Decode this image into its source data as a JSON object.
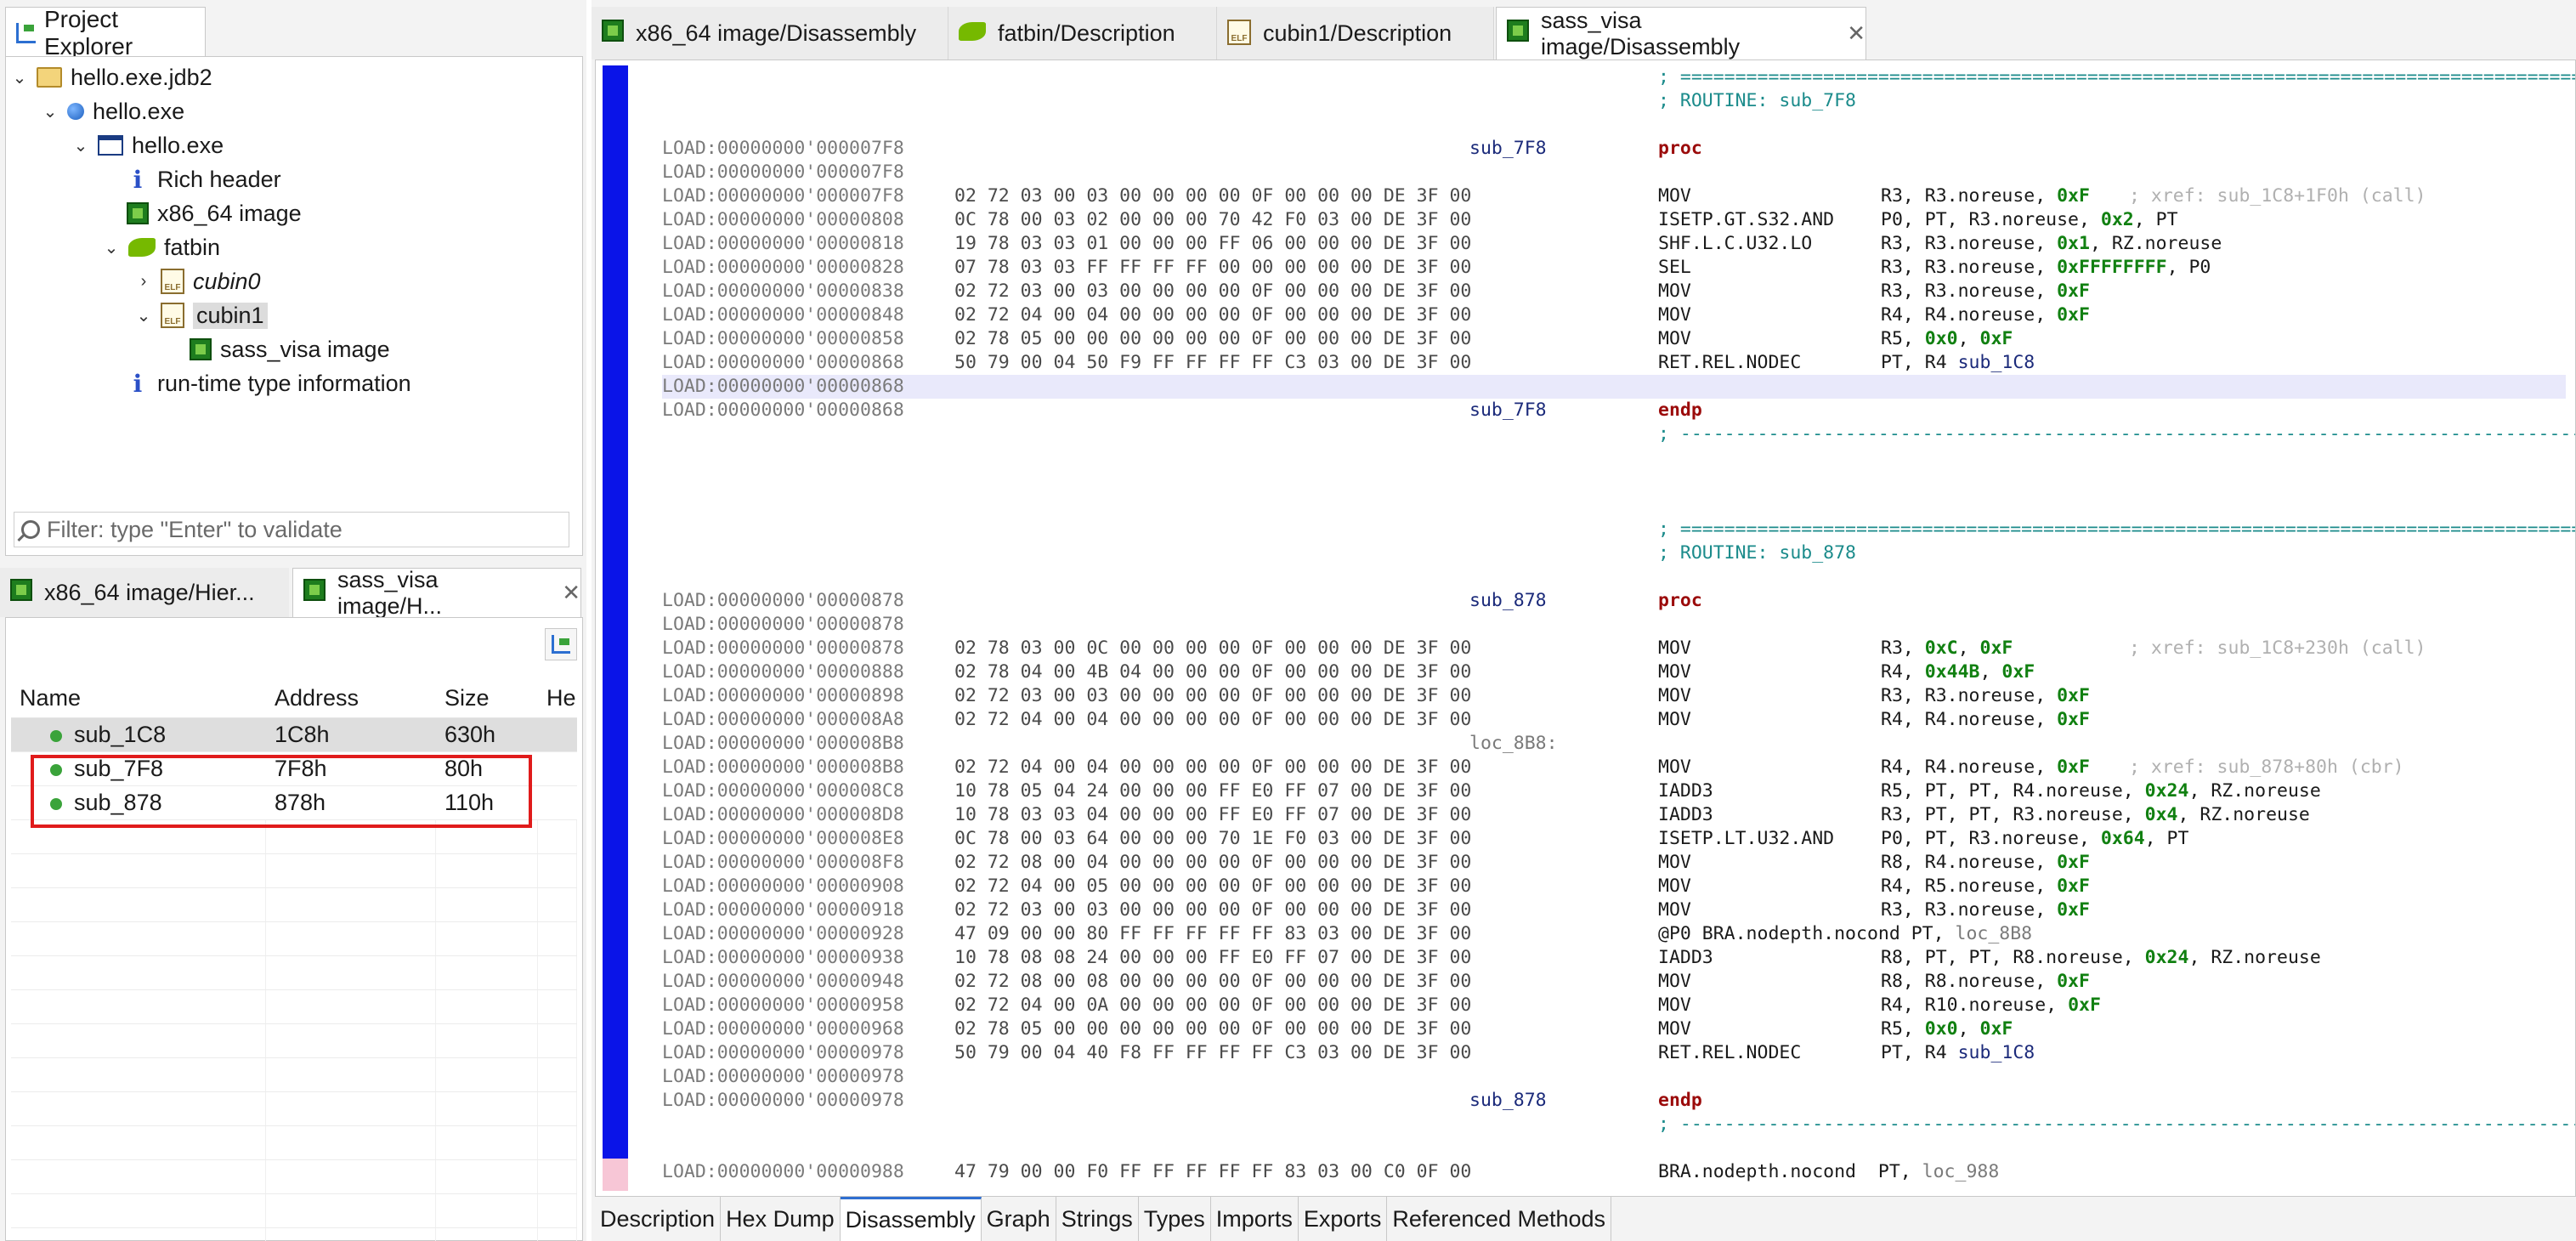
{
  "project_explorer": {
    "tab_label": "Project Explorer",
    "tree": [
      {
        "label": "hello.exe.jdb2",
        "icon": "folder-icon",
        "expanded": true
      },
      {
        "label": "hello.exe",
        "icon": "artifact-icon",
        "expanded": true
      },
      {
        "label": "hello.exe",
        "icon": "window-icon",
        "expanded": true
      },
      {
        "label": "Rich header",
        "icon": "info-icon"
      },
      {
        "label": "x86_64 image",
        "icon": "chip-icon"
      },
      {
        "label": "fatbin",
        "icon": "nvidia-icon",
        "expanded": true
      },
      {
        "label": "cubin0",
        "icon": "elf-icon",
        "expanded": false
      },
      {
        "label": "cubin1",
        "icon": "elf-icon",
        "expanded": true
      },
      {
        "label": "sass_visa image",
        "icon": "chip-icon"
      },
      {
        "label": "run-time type information",
        "icon": "info-icon"
      }
    ],
    "filter_placeholder": "Filter: type \"Enter\" to validate"
  },
  "hierarchy": {
    "tabs": [
      {
        "label": "x86_64 image/Hier..."
      },
      {
        "label": "sass_visa image/H..."
      }
    ],
    "columns": [
      "Name",
      "Address",
      "Size",
      "Hei"
    ],
    "rows": [
      {
        "name": "sub_1C8",
        "address": "1C8h",
        "size": "630h"
      },
      {
        "name": "sub_7F8",
        "address": "7F8h",
        "size": "80h"
      },
      {
        "name": "sub_878",
        "address": "878h",
        "size": "110h"
      }
    ]
  },
  "editor_tabs": [
    {
      "label": "x86_64 image/Disassembly"
    },
    {
      "label": "fatbin/Description"
    },
    {
      "label": "cubin1/Description"
    },
    {
      "label": "sass_visa image/Disassembly"
    }
  ],
  "disassembly": {
    "lines": [
      {
        "sep": "; ==================================================================================================="
      },
      {
        "sep": "; ROUTINE: sub_7F8"
      },
      {},
      {
        "addr": "LOAD:00000000'000007F8",
        "label": "sub_7F8",
        "mn": "proc",
        "kw": true
      },
      {
        "addr": "LOAD:00000000'000007F8"
      },
      {
        "addr": "LOAD:00000000'000007F8",
        "bytes": "02 72 03 00 03 00 00 00 00 0F 00 00 00 DE 3F 00",
        "mn": "MOV",
        "ops": [
          [
            "R3, R3.noreuse, ",
            ""
          ],
          [
            "0xF",
            "hex"
          ]
        ],
        "cm": "; xref: sub_1C8+1F0h (call)"
      },
      {
        "addr": "LOAD:00000000'00000808",
        "bytes": "0C 78 00 03 02 00 00 00 70 42 F0 03 00 DE 3F 00",
        "mn": "ISETP.GT.S32.AND",
        "ops": [
          [
            "P0, PT, R3.noreuse, ",
            ""
          ],
          [
            "0x2",
            "hex"
          ],
          [
            ", PT",
            ""
          ]
        ]
      },
      {
        "addr": "LOAD:00000000'00000818",
        "bytes": "19 78 03 03 01 00 00 00 FF 06 00 00 00 DE 3F 00",
        "mn": "SHF.L.C.U32.LO",
        "ops": [
          [
            "R3, R3.noreuse, ",
            ""
          ],
          [
            "0x1",
            "hex"
          ],
          [
            ", RZ.noreuse",
            ""
          ]
        ]
      },
      {
        "addr": "LOAD:00000000'00000828",
        "bytes": "07 78 03 03 FF FF FF FF 00 00 00 00 00 DE 3F 00",
        "mn": "SEL",
        "ops": [
          [
            "R3, R3.noreuse, ",
            ""
          ],
          [
            "0xFFFFFFFF",
            "hex"
          ],
          [
            ", P0",
            ""
          ]
        ]
      },
      {
        "addr": "LOAD:00000000'00000838",
        "bytes": "02 72 03 00 03 00 00 00 00 0F 00 00 00 DE 3F 00",
        "mn": "MOV",
        "ops": [
          [
            "R3, R3.noreuse, ",
            ""
          ],
          [
            "0xF",
            "hex"
          ]
        ]
      },
      {
        "addr": "LOAD:00000000'00000848",
        "bytes": "02 72 04 00 04 00 00 00 00 0F 00 00 00 DE 3F 00",
        "mn": "MOV",
        "ops": [
          [
            "R4, R4.noreuse, ",
            ""
          ],
          [
            "0xF",
            "hex"
          ]
        ]
      },
      {
        "addr": "LOAD:00000000'00000858",
        "bytes": "02 78 05 00 00 00 00 00 00 0F 00 00 00 DE 3F 00",
        "mn": "MOV",
        "ops": [
          [
            "R5, ",
            ""
          ],
          [
            "0x0",
            "hex"
          ],
          [
            ", ",
            ""
          ],
          [
            "0xF",
            "hex"
          ]
        ]
      },
      {
        "addr": "LOAD:00000000'00000868",
        "bytes": "50 79 00 04 50 F9 FF FF FF FF C3 03 00 DE 3F 00",
        "mn": "RET.REL.NODEC",
        "ops": [
          [
            "PT, R4 ",
            ""
          ],
          [
            "sub_1C8",
            "ref"
          ]
        ]
      },
      {
        "addr": "LOAD:00000000'00000868",
        "hl": true
      },
      {
        "addr": "LOAD:00000000'00000868",
        "label": "sub_7F8",
        "mn": "endp",
        "kw": true
      },
      {
        "sep": "; ---------------------------------------------------------------------------------------------------"
      },
      {},
      {},
      {},
      {
        "sep": "; ==================================================================================================="
      },
      {
        "sep": "; ROUTINE: sub_878"
      },
      {},
      {
        "addr": "LOAD:00000000'00000878",
        "label": "sub_878",
        "mn": "proc",
        "kw": true
      },
      {
        "addr": "LOAD:00000000'00000878"
      },
      {
        "addr": "LOAD:00000000'00000878",
        "bytes": "02 78 03 00 0C 00 00 00 00 0F 00 00 00 DE 3F 00",
        "mn": "MOV",
        "ops": [
          [
            "R3, ",
            ""
          ],
          [
            "0xC",
            "hex"
          ],
          [
            ", ",
            ""
          ],
          [
            "0xF",
            "hex"
          ]
        ],
        "cm": "; xref: sub_1C8+230h (call)"
      },
      {
        "addr": "LOAD:00000000'00000888",
        "bytes": "02 78 04 00 4B 04 00 00 00 0F 00 00 00 DE 3F 00",
        "mn": "MOV",
        "ops": [
          [
            "R4, ",
            ""
          ],
          [
            "0x44B",
            "hex"
          ],
          [
            ", ",
            ""
          ],
          [
            "0xF",
            "hex"
          ]
        ]
      },
      {
        "addr": "LOAD:00000000'00000898",
        "bytes": "02 72 03 00 03 00 00 00 00 0F 00 00 00 DE 3F 00",
        "mn": "MOV",
        "ops": [
          [
            "R3, R3.noreuse, ",
            ""
          ],
          [
            "0xF",
            "hex"
          ]
        ]
      },
      {
        "addr": "LOAD:00000000'000008A8",
        "bytes": "02 72 04 00 04 00 00 00 00 0F 00 00 00 DE 3F 00",
        "mn": "MOV",
        "ops": [
          [
            "R4, R4.noreuse, ",
            ""
          ],
          [
            "0xF",
            "hex"
          ]
        ]
      },
      {
        "addr": "LOAD:00000000'000008B8",
        "label": "loc_8B8:",
        "labelgray": true
      },
      {
        "addr": "LOAD:00000000'000008B8",
        "bytes": "02 72 04 00 04 00 00 00 00 0F 00 00 00 DE 3F 00",
        "mn": "MOV",
        "ops": [
          [
            "R4, R4.noreuse, ",
            ""
          ],
          [
            "0xF",
            "hex"
          ]
        ],
        "cm": "; xref: sub_878+80h (cbr)"
      },
      {
        "addr": "LOAD:00000000'000008C8",
        "bytes": "10 78 05 04 24 00 00 00 FF E0 FF 07 00 DE 3F 00",
        "mn": "IADD3",
        "ops": [
          [
            "R5, PT, PT, R4.noreuse, ",
            ""
          ],
          [
            "0x24",
            "hex"
          ],
          [
            ", RZ.noreuse",
            ""
          ]
        ]
      },
      {
        "addr": "LOAD:00000000'000008D8",
        "bytes": "10 78 03 03 04 00 00 00 FF E0 FF 07 00 DE 3F 00",
        "mn": "IADD3",
        "ops": [
          [
            "R3, PT, PT, R3.noreuse, ",
            ""
          ],
          [
            "0x4",
            "hex"
          ],
          [
            ", RZ.noreuse",
            ""
          ]
        ]
      },
      {
        "addr": "LOAD:00000000'000008E8",
        "bytes": "0C 78 00 03 64 00 00 00 70 1E F0 03 00 DE 3F 00",
        "mn": "ISETP.LT.U32.AND",
        "ops": [
          [
            "P0, PT, R3.noreuse, ",
            ""
          ],
          [
            "0x64",
            "hex"
          ],
          [
            ", PT",
            ""
          ]
        ]
      },
      {
        "addr": "LOAD:00000000'000008F8",
        "bytes": "02 72 08 00 04 00 00 00 00 0F 00 00 00 DE 3F 00",
        "mn": "MOV",
        "ops": [
          [
            "R8, R4.noreuse, ",
            ""
          ],
          [
            "0xF",
            "hex"
          ]
        ]
      },
      {
        "addr": "LOAD:00000000'00000908",
        "bytes": "02 72 04 00 05 00 00 00 00 0F 00 00 00 DE 3F 00",
        "mn": "MOV",
        "ops": [
          [
            "R4, R5.noreuse, ",
            ""
          ],
          [
            "0xF",
            "hex"
          ]
        ]
      },
      {
        "addr": "LOAD:00000000'00000918",
        "bytes": "02 72 03 00 03 00 00 00 00 0F 00 00 00 DE 3F 00",
        "mn": "MOV",
        "ops": [
          [
            "R3, R3.noreuse, ",
            ""
          ],
          [
            "0xF",
            "hex"
          ]
        ]
      },
      {
        "addr": "LOAD:00000000'00000928",
        "bytes": "47 09 00 00 80 FF FF FF FF FF 83 03 00 DE 3F 00",
        "mn": "@P0 BRA.nodepth.nocond PT, ",
        "mnlref": "loc_8B8"
      },
      {
        "addr": "LOAD:00000000'00000938",
        "bytes": "10 78 08 08 24 00 00 00 FF E0 FF 07 00 DE 3F 00",
        "mn": "IADD3",
        "ops": [
          [
            "R8, PT, PT, R8.noreuse, ",
            ""
          ],
          [
            "0x24",
            "hex"
          ],
          [
            ", RZ.noreuse",
            ""
          ]
        ]
      },
      {
        "addr": "LOAD:00000000'00000948",
        "bytes": "02 72 08 00 08 00 00 00 00 0F 00 00 00 DE 3F 00",
        "mn": "MOV",
        "ops": [
          [
            "R8, R8.noreuse, ",
            ""
          ],
          [
            "0xF",
            "hex"
          ]
        ]
      },
      {
        "addr": "LOAD:00000000'00000958",
        "bytes": "02 72 04 00 0A 00 00 00 00 0F 00 00 00 DE 3F 00",
        "mn": "MOV",
        "ops": [
          [
            "R4, R10.noreuse, ",
            ""
          ],
          [
            "0xF",
            "hex"
          ]
        ]
      },
      {
        "addr": "LOAD:00000000'00000968",
        "bytes": "02 78 05 00 00 00 00 00 00 0F 00 00 00 DE 3F 00",
        "mn": "MOV",
        "ops": [
          [
            "R5, ",
            ""
          ],
          [
            "0x0",
            "hex"
          ],
          [
            ", ",
            ""
          ],
          [
            "0xF",
            "hex"
          ]
        ]
      },
      {
        "addr": "LOAD:00000000'00000978",
        "bytes": "50 79 00 04 40 F8 FF FF FF FF C3 03 00 DE 3F 00",
        "mn": "RET.REL.NODEC",
        "ops": [
          [
            "PT, R4 ",
            ""
          ],
          [
            "sub_1C8",
            "ref"
          ]
        ]
      },
      {
        "addr": "LOAD:00000000'00000978"
      },
      {
        "addr": "LOAD:00000000'00000978",
        "label": "sub_878",
        "mn": "endp",
        "kw": true
      },
      {
        "sep": "; ---------------------------------------------------------------------------------------------------"
      },
      {},
      {
        "addr": "LOAD:00000000'00000988",
        "bytes": "47 79 00 00 F0 FF FF FF FF FF 83 03 00 C0 0F 00",
        "mn": "BRA.nodepth.nocond  PT, ",
        "mnlref": "loc_988"
      }
    ]
  },
  "bottom_tabs": [
    {
      "label": "Description"
    },
    {
      "label": "Hex Dump"
    },
    {
      "label": "Disassembly",
      "active": true
    },
    {
      "label": "Graph"
    },
    {
      "label": "Strings"
    },
    {
      "label": "Types"
    },
    {
      "label": "Imports"
    },
    {
      "label": "Exports"
    },
    {
      "label": "Referenced Methods"
    }
  ],
  "colors": {
    "navbar": "#0a14e8",
    "selection_box": "#e01b1b",
    "hex_literal": "#118011"
  }
}
